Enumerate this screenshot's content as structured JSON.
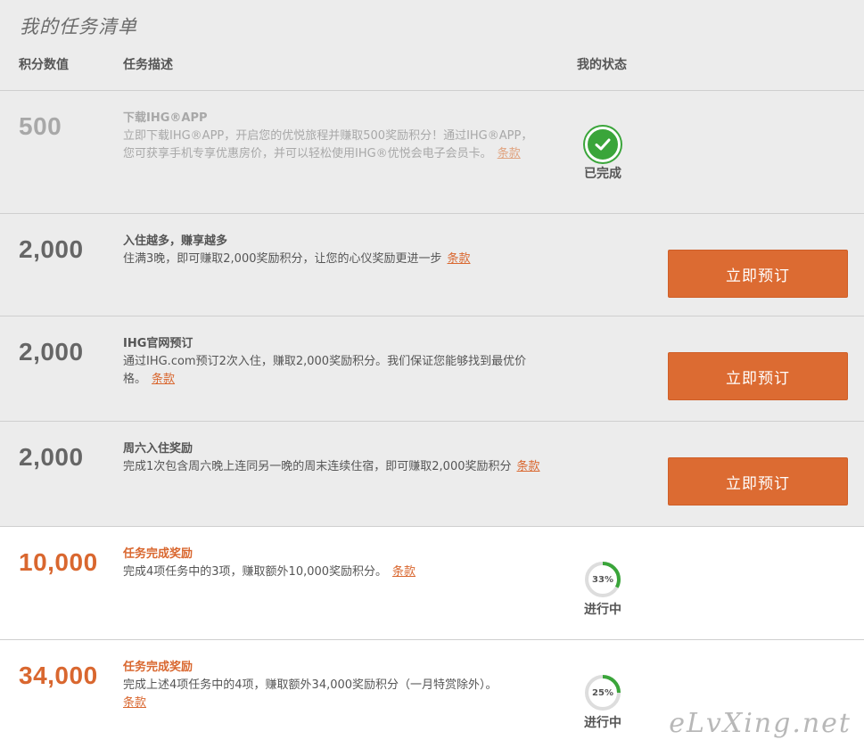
{
  "header": {
    "title": "我的任务清单",
    "col_points": "积分数值",
    "col_desc": "任务描述",
    "col_status": "我的状态"
  },
  "tasks": [
    {
      "points": "500",
      "title": "下载IHG®APP",
      "desc": "立即下载IHG®APP，开启您的优悦旅程并赚取500奖励积分！通过IHG®APP，您可获享手机专享优惠房价，并可以轻松使用IHG®优悦会电子会员卡。",
      "terms": "条款",
      "status_icon": "check-circle-icon",
      "status_label": "已完成"
    },
    {
      "points": "2,000",
      "title": "入住越多，赚享越多",
      "desc": "住满3晚，即可赚取2,000奖励积分，让您的心仪奖励更进一步",
      "terms": "条款",
      "button": "立即预订"
    },
    {
      "points": "2,000",
      "title": "IHG官网预订",
      "desc": "通过IHG.com预订2次入住，赚取2,000奖励积分。我们保证您能够找到最优价格。",
      "terms": "条款",
      "button": "立即预订"
    },
    {
      "points": "2,000",
      "title": "周六入住奖励",
      "desc": "完成1次包含周六晚上连同另一晚的周末连续住宿，即可赚取2,000奖励积分",
      "terms": "条款",
      "button": "立即预订"
    },
    {
      "points": "10,000",
      "title": "任务完成奖励",
      "desc": "完成4项任务中的3项，赚取额外10,000奖励积分。",
      "terms": "条款",
      "progress": 0.33,
      "progress_label": "33%",
      "status_label": "进行中"
    },
    {
      "points": "34,000",
      "title": "任务完成奖励",
      "desc": "完成上述4项任务中的4项，赚取额外34,000奖励积分（一月特赏除外）。",
      "terms": "条款",
      "progress": 0.25,
      "progress_label": "25%",
      "status_label": "进行中"
    }
  ],
  "watermark": "eLvXing.net",
  "colors": {
    "accent": "#dc6b32",
    "complete_green": "#3aa53a",
    "row_grey": "#ececec"
  }
}
